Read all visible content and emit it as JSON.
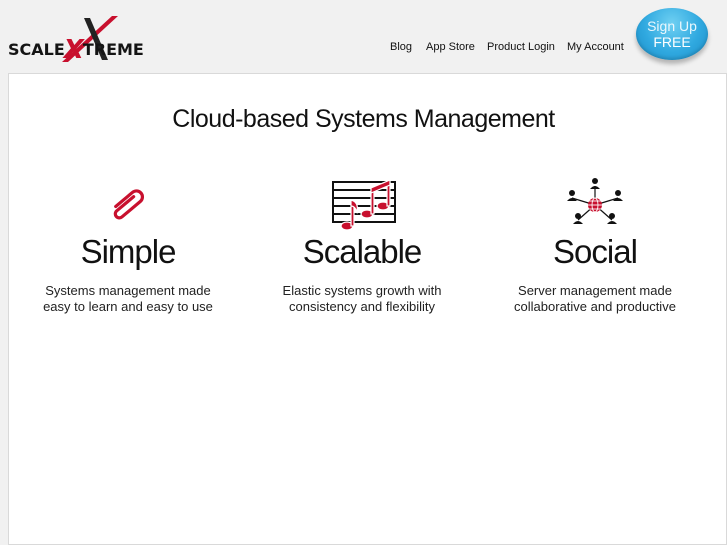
{
  "logo": {
    "text_before": "SCALE",
    "text_x": "X",
    "text_after": "TREME"
  },
  "nav": {
    "blog": "Blog",
    "app_store": "App Store",
    "product_login": "Product Login",
    "my_account": "My Account"
  },
  "signup": {
    "line1": "Sign Up",
    "line2": "FREE"
  },
  "headline": "Cloud-based Systems Management",
  "features": [
    {
      "icon": "paperclip-icon",
      "title": "Simple",
      "desc_line1": "Systems management made",
      "desc_line2": "easy to learn and easy to use"
    },
    {
      "icon": "music-notes-icon",
      "title": "Scalable",
      "desc_line1": "Elastic systems growth with",
      "desc_line2": "consistency and flexibility"
    },
    {
      "icon": "network-people-icon",
      "title": "Social",
      "desc_line1": "Server management made",
      "desc_line2": "collaborative and productive"
    }
  ],
  "colors": {
    "brand_red": "#c8102e",
    "button_blue": "#30a9e0",
    "background": "#f1f1f1"
  }
}
